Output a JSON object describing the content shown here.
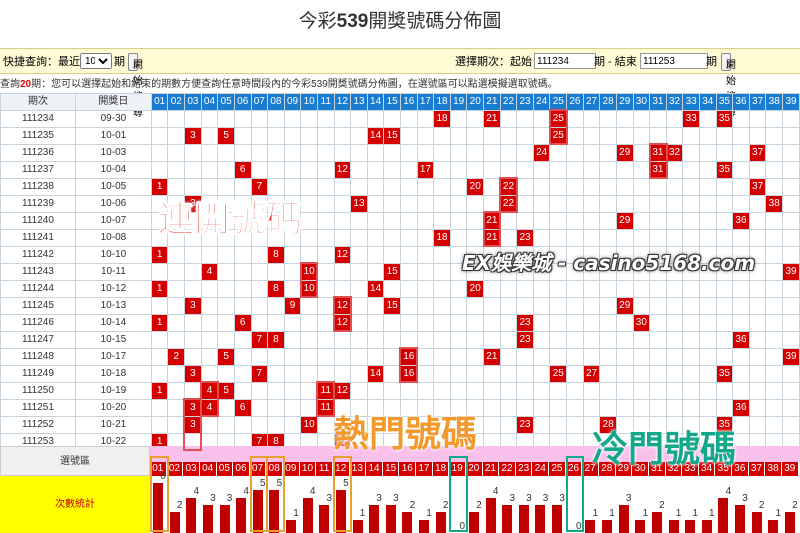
{
  "page": {
    "title_prefix": "今彩",
    "title_num": "539",
    "title_suffix": "開獎號碼分佈圖"
  },
  "query": {
    "quick_label": "快捷查詢：最近",
    "quick_value": "10",
    "quick_unit": "期",
    "search_btn": "開始搜尋",
    "select_label": "選擇期次：起始",
    "start_value": "111234",
    "end_label": "期 - 結束",
    "end_value": "111253",
    "end_unit": "期",
    "search_btn2": "開始搜尋"
  },
  "info": {
    "prefix": "查詢",
    "count": "20",
    "suffix": "期：您可以選擇起始和結束的期數方便查詢任意時間段內的今彩539開獎號碼分佈圖，在選號區可以點選模擬選取號碼。"
  },
  "table": {
    "col_period": "期次",
    "col_date": "開獎日",
    "numbers": [
      "01",
      "02",
      "03",
      "04",
      "05",
      "06",
      "07",
      "08",
      "09",
      "10",
      "11",
      "12",
      "13",
      "14",
      "15",
      "16",
      "17",
      "18",
      "19",
      "20",
      "21",
      "22",
      "23",
      "24",
      "25",
      "26",
      "27",
      "28",
      "29",
      "30",
      "31",
      "32",
      "33",
      "34",
      "35",
      "36",
      "37",
      "38",
      "39"
    ],
    "rows": [
      {
        "period": "111234",
        "date": "09-30",
        "hits": [
          18,
          21,
          25,
          33,
          35
        ]
      },
      {
        "period": "111235",
        "date": "10-01",
        "hits": [
          3,
          5,
          14,
          15,
          25
        ]
      },
      {
        "period": "111236",
        "date": "10-03",
        "hits": [
          24,
          29,
          31,
          32,
          37
        ]
      },
      {
        "period": "111237",
        "date": "10-04",
        "hits": [
          6,
          12,
          17,
          31,
          35
        ]
      },
      {
        "period": "111238",
        "date": "10-05",
        "hits": [
          1,
          7,
          20,
          22,
          37
        ]
      },
      {
        "period": "111239",
        "date": "10-06",
        "hits": [
          3,
          13,
          22,
          38
        ]
      },
      {
        "period": "111240",
        "date": "10-07",
        "hits": [
          21,
          29,
          36
        ]
      },
      {
        "period": "111241",
        "date": "10-08",
        "hits": [
          18,
          21,
          23
        ]
      },
      {
        "period": "111242",
        "date": "10-10",
        "hits": [
          1,
          8,
          12
        ]
      },
      {
        "period": "111243",
        "date": "10-11",
        "hits": [
          4,
          10,
          15,
          39
        ]
      },
      {
        "period": "111244",
        "date": "10-12",
        "hits": [
          1,
          8,
          10,
          14,
          20
        ]
      },
      {
        "period": "111245",
        "date": "10-13",
        "hits": [
          3,
          9,
          12,
          15,
          29
        ]
      },
      {
        "period": "111246",
        "date": "10-14",
        "hits": [
          1,
          6,
          12,
          23,
          30
        ]
      },
      {
        "period": "111247",
        "date": "10-15",
        "hits": [
          7,
          8,
          23,
          36
        ]
      },
      {
        "period": "111248",
        "date": "10-17",
        "hits": [
          2,
          5,
          16,
          21,
          39
        ]
      },
      {
        "period": "111249",
        "date": "10-18",
        "hits": [
          3,
          7,
          14,
          16,
          25,
          27,
          35
        ]
      },
      {
        "period": "111250",
        "date": "10-19",
        "hits": [
          1,
          4,
          5,
          11,
          12
        ]
      },
      {
        "period": "111251",
        "date": "10-20",
        "hits": [
          3,
          4,
          6,
          11,
          36
        ]
      },
      {
        "period": "111252",
        "date": "10-21",
        "hits": [
          3,
          10,
          23,
          28,
          35
        ]
      },
      {
        "period": "111253",
        "date": "10-22",
        "hits": [
          1,
          7,
          8,
          12
        ]
      }
    ]
  },
  "select_area": {
    "label": "選號區"
  },
  "stats": {
    "label": "次數統計",
    "counts": [
      6,
      2,
      4,
      3,
      3,
      4,
      5,
      5,
      1,
      4,
      3,
      5,
      1,
      3,
      3,
      2,
      1,
      2,
      0,
      2,
      4,
      3,
      3,
      3,
      3,
      0,
      1,
      1,
      3,
      1,
      2,
      1,
      1,
      1,
      4,
      3,
      2,
      1,
      2
    ]
  },
  "overlays": {
    "consecutive": "連開號碼",
    "hot": "熱門號碼",
    "cold": "冷門號碼",
    "watermark": "EX娛樂城 - casino5168.com"
  }
}
